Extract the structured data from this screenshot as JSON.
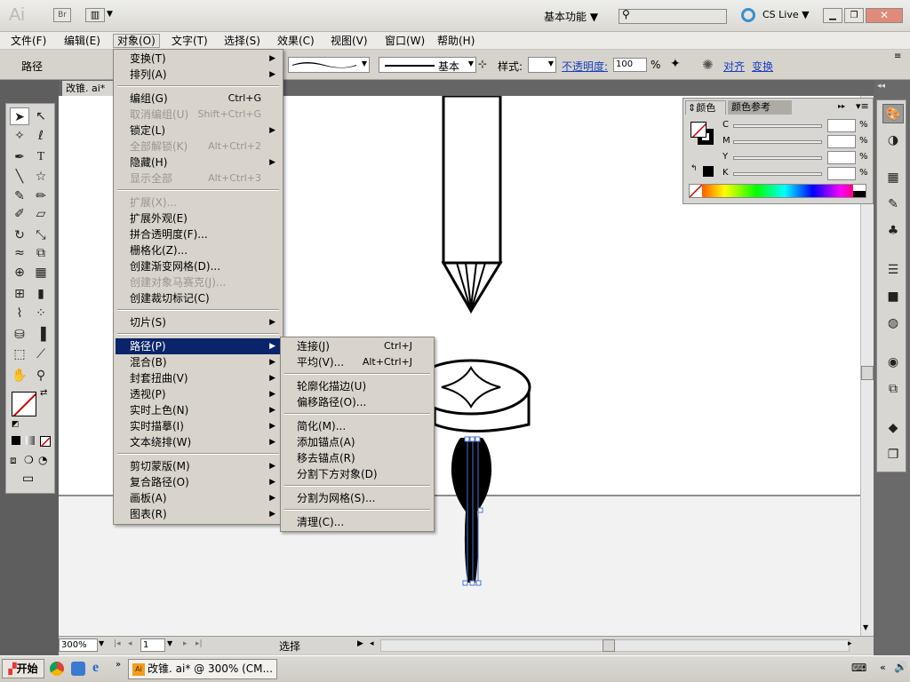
{
  "app": {
    "logo": "Ai",
    "bridge": "Br",
    "workspace": "基本功能",
    "cslive": "CS Live"
  },
  "menubar": [
    "文件(F)",
    "编辑(E)",
    "对象(O)",
    "文字(T)",
    "选择(S)",
    "效果(C)",
    "视图(V)",
    "窗口(W)",
    "帮助(H)"
  ],
  "control": {
    "path_label": "路径",
    "stroke_profile": "基本",
    "style_label": "样式:",
    "opacity_label": "不透明度:",
    "opacity_value": "100",
    "opacity_unit": "%",
    "align_link": "对齐",
    "transform_link": "变换"
  },
  "document_tab": "改锥. ai*",
  "object_menu": [
    {
      "label": "变换(T)",
      "shortcut": "",
      "submenu": true,
      "disabled": false
    },
    {
      "label": "排列(A)",
      "shortcut": "",
      "submenu": true,
      "disabled": false
    },
    {
      "label": "编组(G)",
      "shortcut": "Ctrl+G",
      "submenu": false,
      "disabled": false
    },
    {
      "label": "取消编组(U)",
      "shortcut": "Shift+Ctrl+G",
      "submenu": false,
      "disabled": true
    },
    {
      "label": "锁定(L)",
      "shortcut": "",
      "submenu": true,
      "disabled": false
    },
    {
      "label": "全部解锁(K)",
      "shortcut": "Alt+Ctrl+2",
      "submenu": false,
      "disabled": true
    },
    {
      "label": "隐藏(H)",
      "shortcut": "",
      "submenu": true,
      "disabled": false
    },
    {
      "label": "显示全部",
      "shortcut": "Alt+Ctrl+3",
      "submenu": false,
      "disabled": true
    },
    {
      "label": "扩展(X)...",
      "shortcut": "",
      "submenu": false,
      "disabled": true
    },
    {
      "label": "扩展外观(E)",
      "shortcut": "",
      "submenu": false,
      "disabled": false
    },
    {
      "label": "拼合透明度(F)...",
      "shortcut": "",
      "submenu": false,
      "disabled": false
    },
    {
      "label": "栅格化(Z)...",
      "shortcut": "",
      "submenu": false,
      "disabled": false
    },
    {
      "label": "创建渐变网格(D)...",
      "shortcut": "",
      "submenu": false,
      "disabled": false
    },
    {
      "label": "创建对象马赛克(J)...",
      "shortcut": "",
      "submenu": false,
      "disabled": true
    },
    {
      "label": "创建裁切标记(C)",
      "shortcut": "",
      "submenu": false,
      "disabled": false
    },
    {
      "label": "切片(S)",
      "shortcut": "",
      "submenu": true,
      "disabled": false
    },
    {
      "label": "路径(P)",
      "shortcut": "",
      "submenu": true,
      "disabled": false,
      "highlighted": true
    },
    {
      "label": "混合(B)",
      "shortcut": "",
      "submenu": true,
      "disabled": false
    },
    {
      "label": "封套扭曲(V)",
      "shortcut": "",
      "submenu": true,
      "disabled": false
    },
    {
      "label": "透视(P)",
      "shortcut": "",
      "submenu": true,
      "disabled": false
    },
    {
      "label": "实时上色(N)",
      "shortcut": "",
      "submenu": true,
      "disabled": false
    },
    {
      "label": "实时描摹(I)",
      "shortcut": "",
      "submenu": true,
      "disabled": false
    },
    {
      "label": "文本绕排(W)",
      "shortcut": "",
      "submenu": true,
      "disabled": false
    },
    {
      "label": "剪切蒙版(M)",
      "shortcut": "",
      "submenu": true,
      "disabled": false
    },
    {
      "label": "复合路径(O)",
      "shortcut": "",
      "submenu": true,
      "disabled": false
    },
    {
      "label": "画板(A)",
      "shortcut": "",
      "submenu": true,
      "disabled": false
    },
    {
      "label": "图表(R)",
      "shortcut": "",
      "submenu": true,
      "disabled": false
    }
  ],
  "path_submenu": [
    {
      "label": "连接(J)",
      "shortcut": "Ctrl+J"
    },
    {
      "label": "平均(V)...",
      "shortcut": "Alt+Ctrl+J"
    },
    {
      "label": "轮廓化描边(U)",
      "shortcut": ""
    },
    {
      "label": "偏移路径(O)...",
      "shortcut": ""
    },
    {
      "label": "简化(M)...",
      "shortcut": ""
    },
    {
      "label": "添加锚点(A)",
      "shortcut": ""
    },
    {
      "label": "移去锚点(R)",
      "shortcut": ""
    },
    {
      "label": "分割下方对象(D)",
      "shortcut": ""
    },
    {
      "label": "分割为网格(S)...",
      "shortcut": ""
    },
    {
      "label": "清理(C)...",
      "shortcut": ""
    }
  ],
  "color_panel": {
    "tab_color": "颜色",
    "tab_guide": "颜色参考",
    "channels": [
      "C",
      "M",
      "Y",
      "K"
    ],
    "unit": "%"
  },
  "status": {
    "zoom": "300%",
    "page": "1",
    "tool": "选择"
  },
  "taskbar": {
    "start": "开始",
    "window": "改锥. ai* @ 300% (CM..."
  }
}
